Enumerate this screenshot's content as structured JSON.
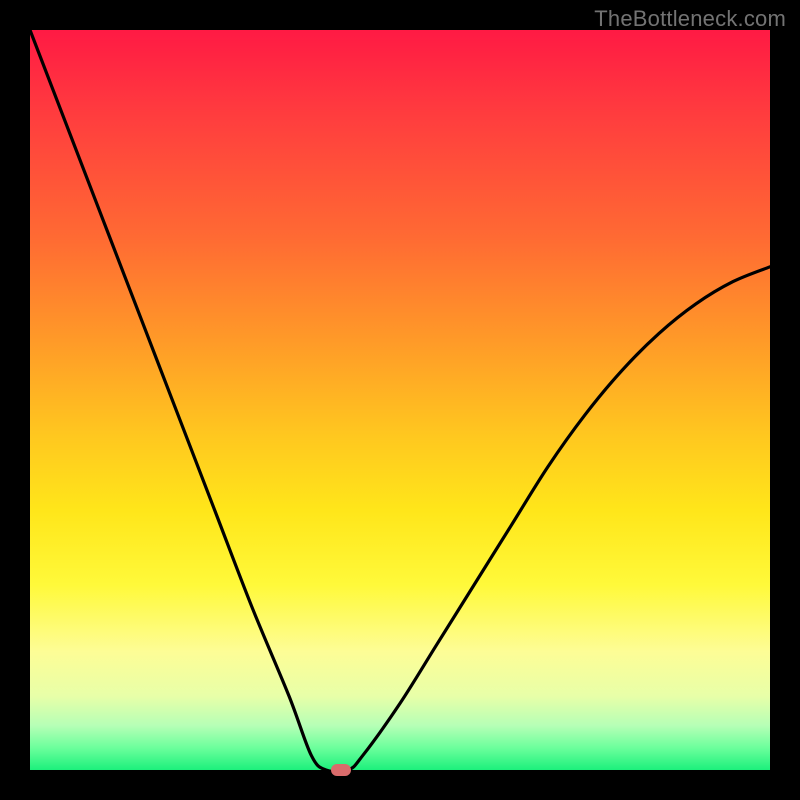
{
  "watermark": "TheBottleneck.com",
  "colors": {
    "frame": "#000000",
    "curve": "#000000",
    "marker": "#d96b6b"
  },
  "chart_data": {
    "type": "line",
    "title": "",
    "xlabel": "",
    "ylabel": "",
    "xlim": [
      0,
      100
    ],
    "ylim": [
      0,
      100
    ],
    "grid": false,
    "legend": false,
    "series": [
      {
        "name": "bottleneck-curve",
        "x": [
          0,
          5,
          10,
          15,
          20,
          25,
          30,
          35,
          38,
          40,
          43,
          45,
          50,
          55,
          60,
          65,
          70,
          75,
          80,
          85,
          90,
          95,
          100
        ],
        "values": [
          100,
          87,
          74,
          61,
          48,
          35,
          22,
          10,
          2,
          0,
          0,
          2,
          9,
          17,
          25,
          33,
          41,
          48,
          54,
          59,
          63,
          66,
          68
        ]
      }
    ],
    "annotations": [
      {
        "name": "min-marker",
        "x": 42,
        "y": 0
      }
    ]
  }
}
